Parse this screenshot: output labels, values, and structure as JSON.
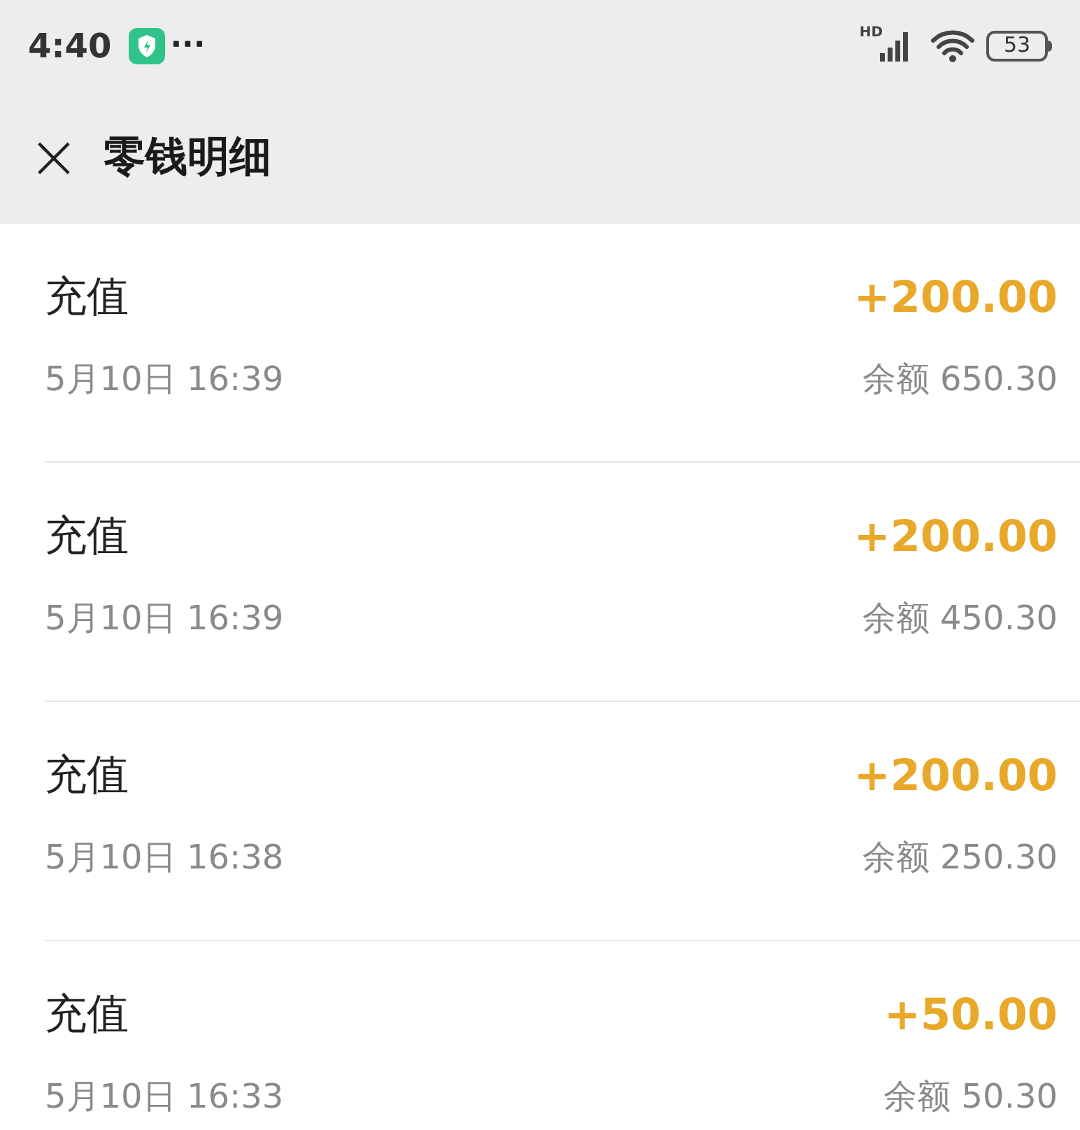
{
  "status_bar": {
    "time": "4:40",
    "more": "···",
    "network": "HD",
    "battery": "53"
  },
  "header": {
    "close": "×",
    "title": "零钱明细"
  },
  "transactions": [
    {
      "type": "充值",
      "date": "5月10日 16:39",
      "amount": "+200.00",
      "balance": "余额 650.30"
    },
    {
      "type": "充值",
      "date": "5月10日 16:39",
      "amount": "+200.00",
      "balance": "余额 450.30"
    },
    {
      "type": "充值",
      "date": "5月10日 16:38",
      "amount": "+200.00",
      "balance": "余额 250.30"
    },
    {
      "type": "充值",
      "date": "5月10日 16:33",
      "amount": "+50.00",
      "balance": "余额 50.30"
    }
  ]
}
